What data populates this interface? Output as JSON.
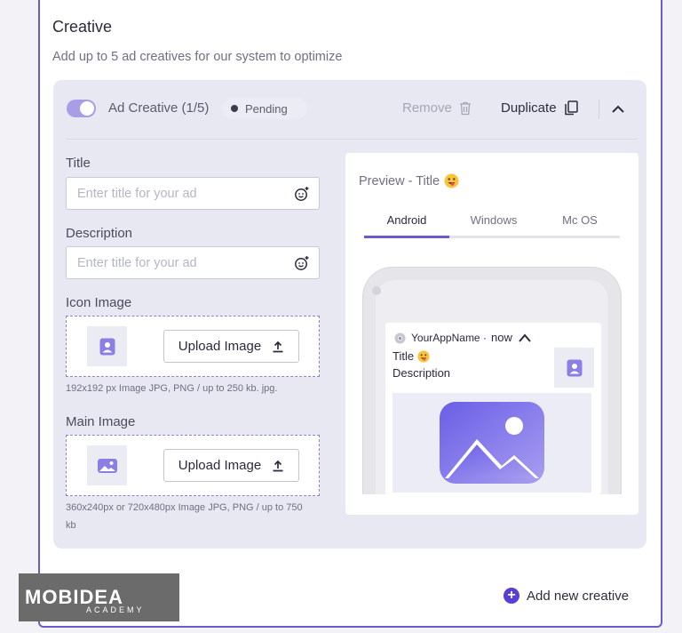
{
  "section": {
    "title": "Creative",
    "subtitle": "Add up to 5 ad creatives for our system to optimize"
  },
  "creative": {
    "label": "Ad Creative (1/5)",
    "status": "Pending",
    "enabled": true,
    "remove_label": "Remove",
    "duplicate_label": "Duplicate"
  },
  "form": {
    "title_label": "Title",
    "title_placeholder": "Enter title for your ad",
    "description_label": "Description",
    "description_placeholder": "Enter title for your ad",
    "icon_label": "Icon Image",
    "icon_upload": "Upload Image",
    "icon_hint": "192x192 px Image JPG, PNG / up to 250 kb. jpg.",
    "main_label": "Main Image",
    "main_upload": "Upload Image",
    "main_hint_1": "360x240px or 720x480px Image JPG, PNG / up to 750",
    "main_hint_2": "kb"
  },
  "preview": {
    "title": "Preview - Title",
    "tabs": [
      "Android",
      "Windows",
      "Mc OS"
    ],
    "active_tab": "Android",
    "app_name": "YourAppName ·",
    "time": "now",
    "notif_title": "Title",
    "notif_description": "Description"
  },
  "footer": {
    "add_label": "Add new creative"
  },
  "watermark": {
    "name": "MOBIDEA",
    "sub": "ACADEMY"
  },
  "colors": {
    "accent": "#6e5bc9",
    "toggle": "#a99ee6",
    "add_button": "#5a3fd6"
  }
}
